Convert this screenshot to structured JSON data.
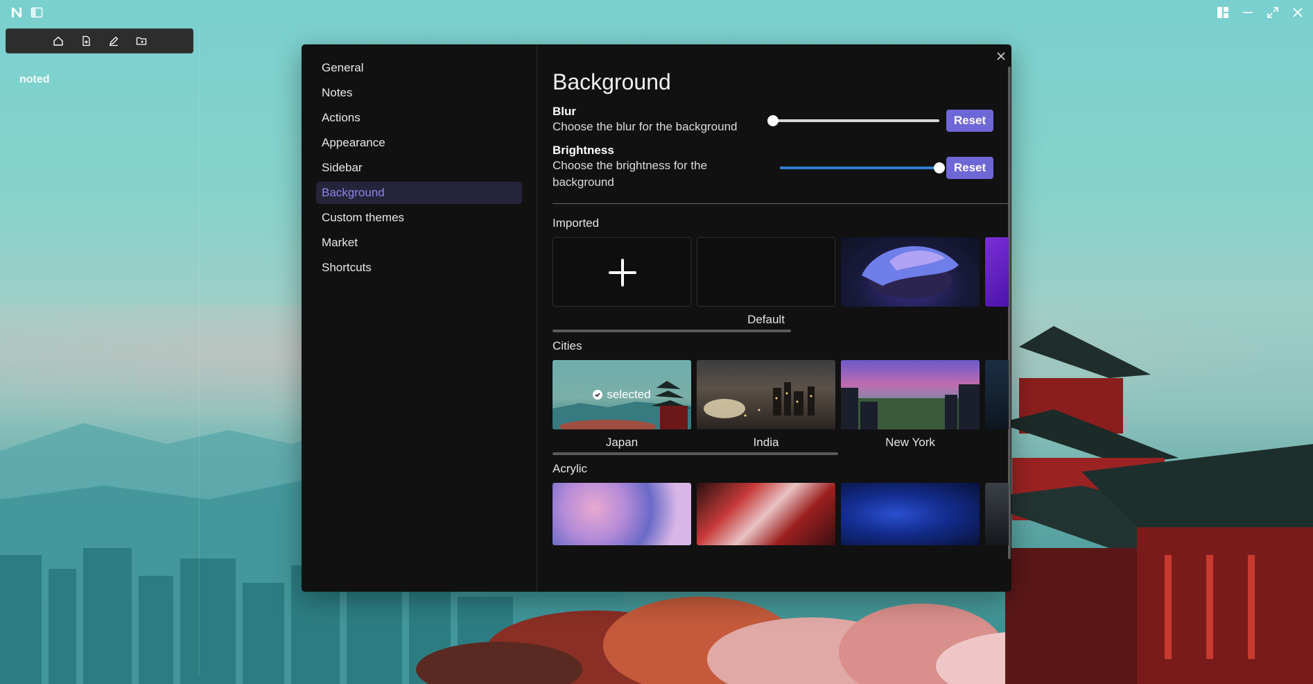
{
  "app": {
    "notebook_name": "noted"
  },
  "settings": {
    "nav": [
      {
        "label": "General"
      },
      {
        "label": "Notes"
      },
      {
        "label": "Actions"
      },
      {
        "label": "Appearance"
      },
      {
        "label": "Sidebar"
      },
      {
        "label": "Background",
        "active": true
      },
      {
        "label": "Custom themes"
      },
      {
        "label": "Market"
      },
      {
        "label": "Shortcuts"
      }
    ],
    "page_title": "Background",
    "blur": {
      "title": "Blur",
      "description": "Choose the blur for the background",
      "reset_label": "Reset",
      "value_fraction": 0.0
    },
    "brightness": {
      "title": "Brightness",
      "description": "Choose the brightness for the background",
      "reset_label": "Reset",
      "value_fraction": 1.0
    },
    "sections": {
      "imported": {
        "title": "Imported",
        "tiles": [
          {
            "label": ""
          },
          {
            "label": "Default"
          },
          {
            "label": ""
          }
        ]
      },
      "cities": {
        "title": "Cities",
        "tiles": [
          {
            "label": "Japan",
            "selected": true,
            "badge": "selected"
          },
          {
            "label": "India"
          },
          {
            "label": "New York"
          }
        ]
      },
      "acrylic": {
        "title": "Acrylic"
      }
    }
  },
  "icons": {
    "toolbar": [
      "home-icon",
      "new-note-icon",
      "edit-icon",
      "new-folder-icon"
    ],
    "window": [
      "layout-icon",
      "minimize-icon",
      "maximize-icon",
      "close-icon"
    ]
  },
  "colors": {
    "accent": "#6e67d6",
    "active_nav_text": "#8f84e8",
    "modal_bg": "#111111",
    "slider_fill": "#2f7fd0"
  }
}
